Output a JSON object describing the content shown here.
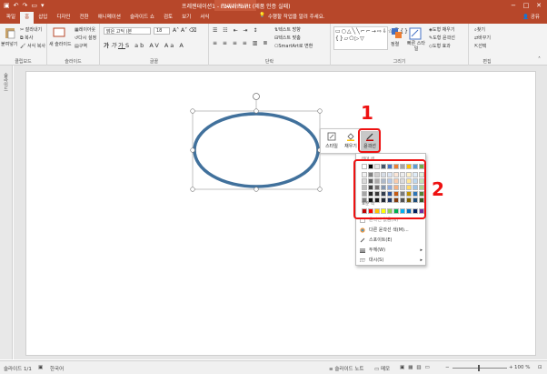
{
  "title_bar": {
    "title": "프레젠테이션1 - PowerPoint (제품 인증 실패)",
    "context_tab": "그리기 도구",
    "qat_icons": [
      "save-icon",
      "undo-icon",
      "redo-icon",
      "present-icon",
      "dropdown-icon"
    ],
    "window_controls": [
      "−",
      "□",
      "✕"
    ]
  },
  "tabs": [
    "파일",
    "홈",
    "삽입",
    "디자인",
    "전환",
    "애니메이션",
    "슬라이드 쇼",
    "검토",
    "보기",
    "서식"
  ],
  "active_tab": "홈",
  "tell_me": "수행할 작업을 알려 주세요.",
  "share_label": "공유",
  "ribbon": {
    "clipboard": {
      "label": "클립보드",
      "paste": "붙여넣기",
      "cut": "잘라내기",
      "copy": "복사",
      "format_painter": "서식 복사"
    },
    "slides": {
      "label": "슬라이드",
      "new_slide": "새 슬라이드",
      "layout": "레이아웃",
      "reset": "다시 설정",
      "section": "구역"
    },
    "font": {
      "label": "글꼴",
      "font_name": "맑은 고딕 (본",
      "font_size": "18"
    },
    "paragraph": {
      "label": "단락",
      "text_direction": "텍스트 방향",
      "align_text": "텍스트 맞춤",
      "smartart": "SmartArt로 변환"
    },
    "drawing": {
      "label": "그리기",
      "arrange": "정렬",
      "quick_styles": "빠른 스타일",
      "shape_fill": "도형 채우기",
      "shape_outline": "도형 윤곽선",
      "shape_effects": "도형 효과"
    },
    "editing": {
      "label": "편집",
      "find": "찾기",
      "replace": "바꾸기",
      "select": "선택"
    }
  },
  "thumb_pane_label": "슬라이드",
  "mini_toolbar": {
    "style": "스타일",
    "fill": "채우기",
    "outline": "윤곽선"
  },
  "color_menu": {
    "theme_colors": "테마 색",
    "standard_colors": "표준 색",
    "no_outline": "윤곽선 없음(N)",
    "more_colors": "다른 윤곽선 색(M)...",
    "eyedropper": "스포이트(E)",
    "weight": "두께(W)",
    "dashes": "대시(S)",
    "theme_palette": [
      [
        "#ffffff",
        "#000000",
        "#e7e6e6",
        "#44546a",
        "#4472c4",
        "#ed7d31",
        "#a5a5a5",
        "#ffc000",
        "#5b9bd5",
        "#70ad47"
      ],
      [
        "#f2f2f2",
        "#7f7f7f",
        "#d0cece",
        "#d6dce5",
        "#dae3f3",
        "#fbe5d6",
        "#ededed",
        "#fff2cc",
        "#deebf7",
        "#e2f0d9"
      ],
      [
        "#d9d9d9",
        "#595959",
        "#aeabab",
        "#adb9ca",
        "#b4c7e7",
        "#f8cbad",
        "#dbdbdb",
        "#ffe699",
        "#bdd7ee",
        "#c5e0b4"
      ],
      [
        "#bfbfbf",
        "#404040",
        "#757171",
        "#8497b0",
        "#8faadc",
        "#f4b183",
        "#c9c9c9",
        "#ffd966",
        "#9dc3e6",
        "#a9d18e"
      ],
      [
        "#a6a6a6",
        "#262626",
        "#3a3838",
        "#333f50",
        "#2f5597",
        "#c55a11",
        "#7b7b7b",
        "#bf9000",
        "#2e75b6",
        "#548235"
      ],
      [
        "#7f7f7f",
        "#0d0d0d",
        "#171616",
        "#222a35",
        "#203864",
        "#843c0c",
        "#525252",
        "#7f6000",
        "#1f4e79",
        "#385723"
      ]
    ],
    "standard_palette": [
      "#c00000",
      "#ff0000",
      "#ffc000",
      "#ffff00",
      "#92d050",
      "#00b050",
      "#00b0f0",
      "#0070c0",
      "#002060",
      "#7030a0"
    ]
  },
  "annotations": [
    "1",
    "2"
  ],
  "status_bar": {
    "slide_info": "슬라이드 1/1",
    "language": "한국어",
    "notes": "슬라이드 노트",
    "comments": "메모",
    "zoom": "100 %"
  },
  "colors": {
    "accent": "#b7472a",
    "ellipse_outline": "#41719c",
    "annotation": "#ee1111"
  }
}
